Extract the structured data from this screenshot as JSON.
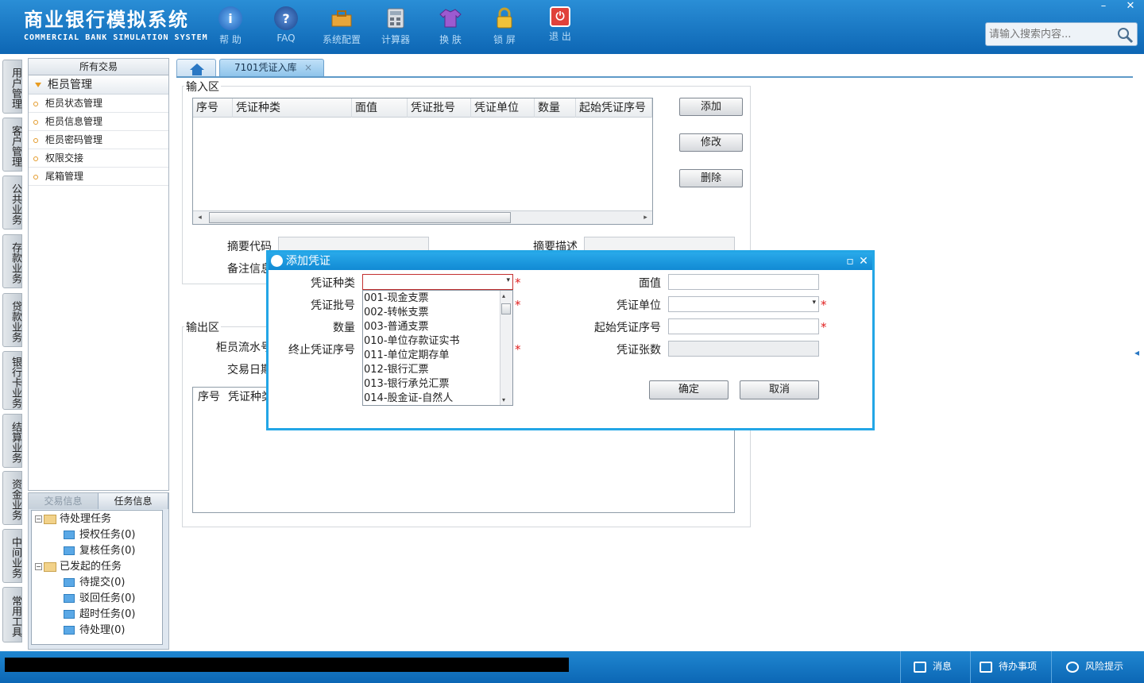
{
  "app": {
    "title_cn": "商业银行模拟系统",
    "title_en": "COMMERCIAL BANK SIMULATION SYSTEM"
  },
  "toolbar": [
    {
      "label": "帮 助",
      "icon": "info-icon"
    },
    {
      "label": "FAQ",
      "icon": "faq-icon"
    },
    {
      "label": "系统配置",
      "icon": "toolbox-icon"
    },
    {
      "label": "计算器",
      "icon": "calculator-icon"
    },
    {
      "label": "换 肤",
      "icon": "shirt-icon"
    },
    {
      "label": "锁 屏",
      "icon": "lock-icon"
    },
    {
      "label": "退 出",
      "icon": "power-icon"
    }
  ],
  "window": {
    "minimize": "–",
    "close": "✕"
  },
  "search": {
    "placeholder": "请输入搜索内容..."
  },
  "sidetabs": [
    "用户管理",
    "客户管理",
    "公共业务",
    "存款业务",
    "贷款业务",
    "银行卡业务",
    "结算业务",
    "资金业务",
    "中间业务",
    "常用工具"
  ],
  "left": {
    "header": "所有交易",
    "category": "柜员管理",
    "items": [
      "柜员状态管理",
      "柜员信息管理",
      "柜员密码管理",
      "权限交接",
      "尾箱管理"
    ]
  },
  "tasks": {
    "tabs": [
      "交易信息",
      "任务信息"
    ],
    "tree": [
      {
        "label": "待处理任务",
        "level": 0
      },
      {
        "label": "授权任务(0)",
        "level": 1
      },
      {
        "label": "复核任务(0)",
        "level": 1
      },
      {
        "label": "已发起的任务",
        "level": 0
      },
      {
        "label": "待提交(0)",
        "level": 1
      },
      {
        "label": "驳回任务(0)",
        "level": 1
      },
      {
        "label": "超时任务(0)",
        "level": 1
      },
      {
        "label": "待处理(0)",
        "level": 1
      }
    ]
  },
  "tabs": {
    "active": "7101凭证入库",
    "close": "×"
  },
  "input_area": {
    "legend": "输入区",
    "columns": [
      "序号",
      "凭证种类",
      "面值",
      "凭证批号",
      "凭证单位",
      "数量",
      "起始凭证序号"
    ],
    "buttons": {
      "add": "添加",
      "edit": "修改",
      "delete": "删除"
    },
    "fields": {
      "summary_code": "摘要代码",
      "summary_desc": "摘要描述",
      "remark": "备注信息"
    }
  },
  "output_area": {
    "legend": "输出区",
    "serial_label": "柜员流水号",
    "date_label": "交易日期",
    "columns": [
      "序号",
      "凭证种类"
    ]
  },
  "dialog": {
    "title": "添加凭证",
    "labels": {
      "kind": "凭证种类",
      "batch": "凭证批号",
      "qty": "数量",
      "end_seq": "终止凭证序号",
      "face": "面值",
      "unit": "凭证单位",
      "start_seq": "起始凭证序号",
      "count": "凭证张数"
    },
    "required": "*",
    "ok": "确定",
    "cancel": "取消",
    "options": [
      "001-现金支票",
      "002-转帐支票",
      "003-普通支票",
      "010-单位存款证实书",
      "011-单位定期存单",
      "012-银行汇票",
      "013-银行承兑汇票",
      "014-股金证-自然人"
    ]
  },
  "statusbar": {
    "message": "消息",
    "todo": "待办事项",
    "risk": "风险提示"
  },
  "colors": {
    "header": "#1478c4",
    "dialog_border": "#23a6e6",
    "required": "#e02020"
  }
}
